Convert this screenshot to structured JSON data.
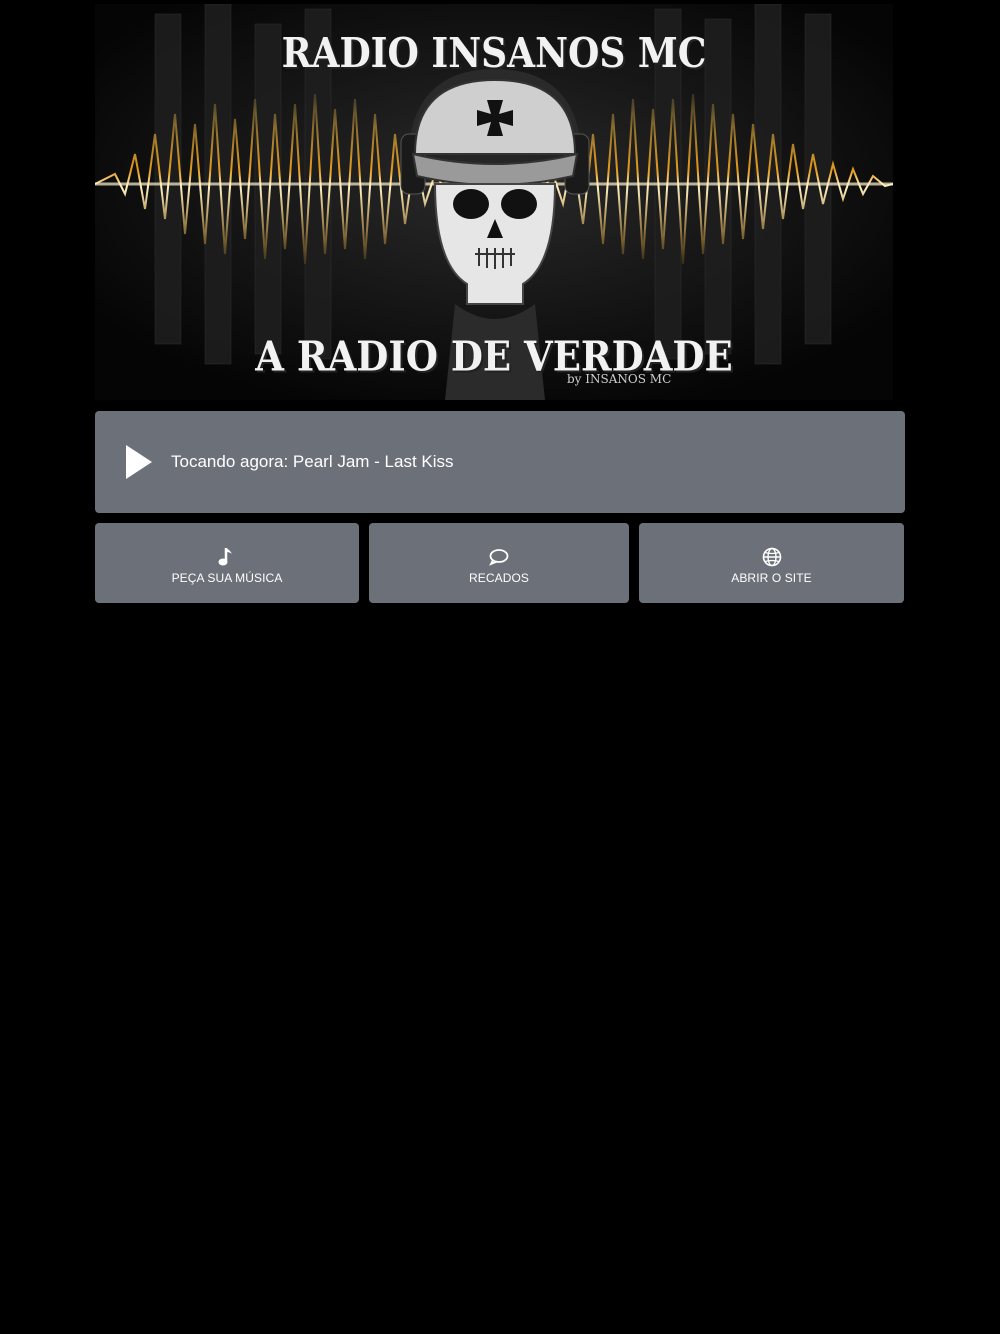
{
  "banner": {
    "title_top": "RADIO INSANOS MC",
    "title_bottom": "A RADIO DE VERDADE",
    "byline": "by INSANOS MC",
    "accent_color": "#f0a21c"
  },
  "player": {
    "now_playing": "Tocando agora: Pearl Jam - Last Kiss",
    "play_icon": "play-icon",
    "background": "#6c7078"
  },
  "actions": [
    {
      "label": "PEÇA SUA MÚSICA",
      "icon": "music-note-icon"
    },
    {
      "label": "RECADOS",
      "icon": "speech-bubble-icon"
    },
    {
      "label": "ABRIR O SITE",
      "icon": "globe-icon"
    }
  ]
}
